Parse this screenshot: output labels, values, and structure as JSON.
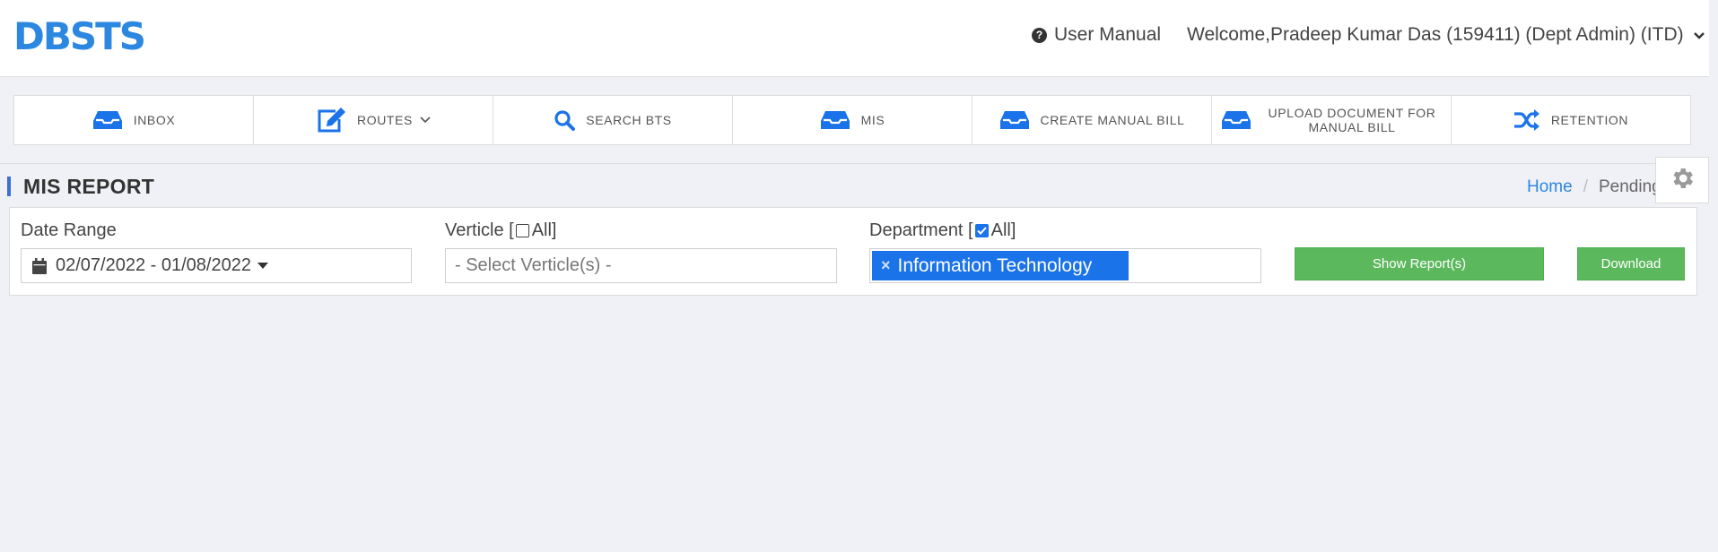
{
  "header": {
    "logo": "DBSTS",
    "user_manual": "User Manual",
    "welcome": "Welcome,Pradeep Kumar Das (159411) (Dept Admin) (ITD)"
  },
  "nav": {
    "items": [
      {
        "label": "INBOX",
        "icon": "inbox-icon"
      },
      {
        "label": "ROUTES",
        "icon": "edit-icon"
      },
      {
        "label": "SEARCH BTS",
        "icon": "search-icon"
      },
      {
        "label": "MIS",
        "icon": "inbox-icon"
      },
      {
        "label": "CREATE MANUAL BILL",
        "icon": "inbox-icon"
      },
      {
        "label": "UPLOAD DOCUMENT FOR MANUAL BILL",
        "icon": "inbox-icon"
      },
      {
        "label": "RETENTION",
        "icon": "shuffle-icon"
      }
    ]
  },
  "page": {
    "title": "MIS REPORT",
    "breadcrumb": {
      "home": "Home",
      "separator": "/",
      "current": "Pending"
    }
  },
  "filters": {
    "date_range": {
      "label": "Date Range",
      "value": "02/07/2022 - 01/08/2022"
    },
    "verticle": {
      "label_prefix": "Verticle [",
      "label_all": "All]",
      "all_checked": false,
      "placeholder": "- Select Verticle(s) -"
    },
    "department": {
      "label_prefix": "Department [",
      "label_all": "All]",
      "all_checked": true,
      "selected": [
        "Information Technology"
      ],
      "remove_symbol": "×"
    },
    "show_button": "Show Report(s)",
    "download_button": "Download"
  },
  "colors": {
    "brand": "#2b87e0",
    "nav_icon": "#1a73e8",
    "tag_bg": "#1a73e8",
    "button_green": "#5cb85c",
    "page_bg": "#f0f1f6",
    "title_accent": "#3b6fd6"
  }
}
